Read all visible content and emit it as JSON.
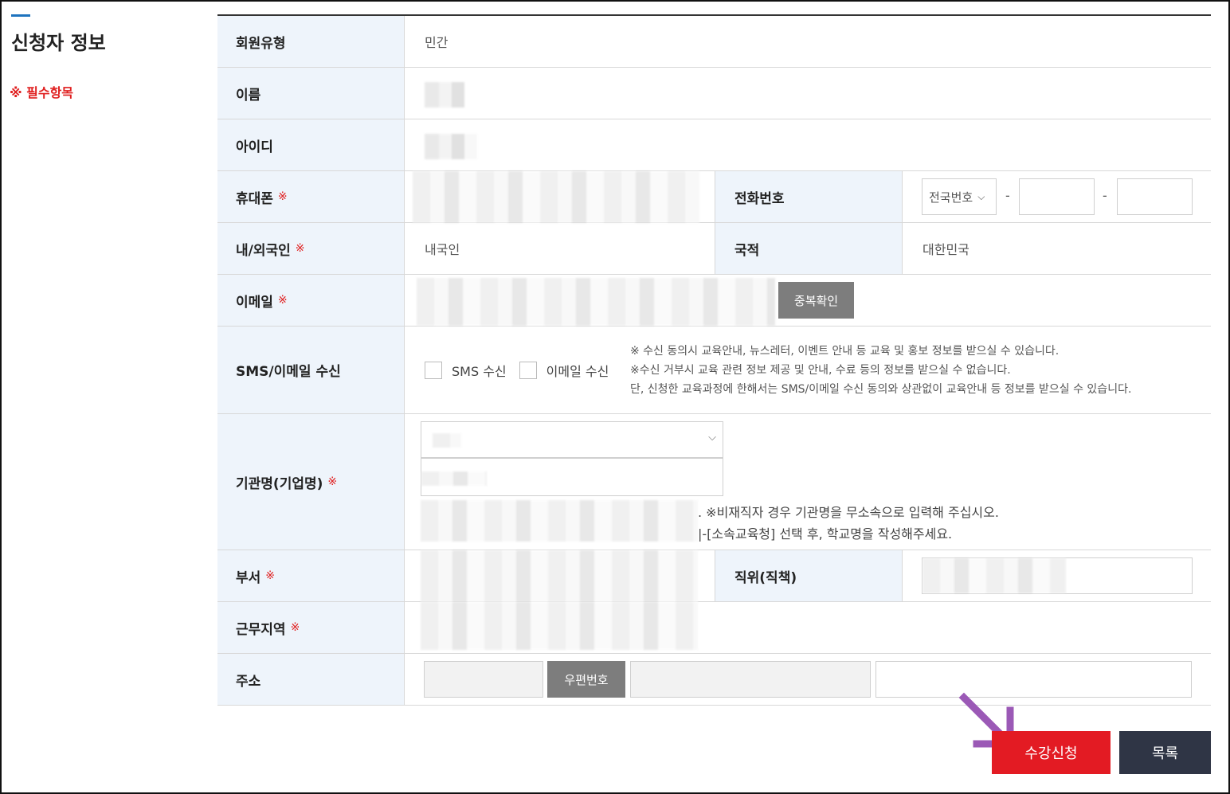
{
  "sidebar": {
    "title": "신청자 정보",
    "required_note": "※ 필수항목"
  },
  "required_mark": "※",
  "rows": {
    "member_type": {
      "label": "회원유형",
      "value": "민간"
    },
    "name": {
      "label": "이름"
    },
    "user_id": {
      "label": "아이디"
    },
    "mobile": {
      "label": "휴대폰"
    },
    "phone": {
      "label": "전화번호",
      "select": "전국번호",
      "dash": "-"
    },
    "nationality_type": {
      "label": "내/외국인",
      "value": "내국인"
    },
    "nationality": {
      "label": "국적",
      "value": "대한민국"
    },
    "email": {
      "label": "이메일",
      "check_button": "중복확인"
    },
    "sms_email": {
      "label": "SMS/이메일 수신",
      "sms_option": "SMS 수신",
      "email_option": "이메일 수신",
      "notices": [
        "※ 수신 동의시 교육안내, 뉴스레터, 이벤트 안내 등 교육 및 홍보 정보를 받으실 수 있습니다.",
        "※수신 거부시 교육 관련 정보 제공 및 안내, 수료 등의 정보를 받으실 수 없습니다.",
        "단, 신청한 교육과정에 한해서는 SMS/이메일 수신 동의와 상관없이 교육안내 등 정보를 받으실 수 있습니다."
      ]
    },
    "organization": {
      "label": "기관명(기업명)",
      "notes": [
        ". ※비재직자 경우 기관명을 무소속으로 입력해 주십시오.",
        "|-[소속교육청] 선택 후, 학교명을 작성해주세요."
      ]
    },
    "department": {
      "label": "부서"
    },
    "position": {
      "label": "직위(직책)"
    },
    "work_region": {
      "label": "근무지역"
    },
    "address": {
      "label": "주소",
      "zipcode_button": "우편번호"
    }
  },
  "actions": {
    "apply": "수강신청",
    "list": "목록"
  },
  "colors": {
    "accent_blue": "#1e73be",
    "required_red": "#e02020",
    "apply_red": "#e31b23",
    "list_navy": "#2f3545",
    "header_bg": "#eef4fb",
    "arrow_purple": "#9b59b6"
  }
}
